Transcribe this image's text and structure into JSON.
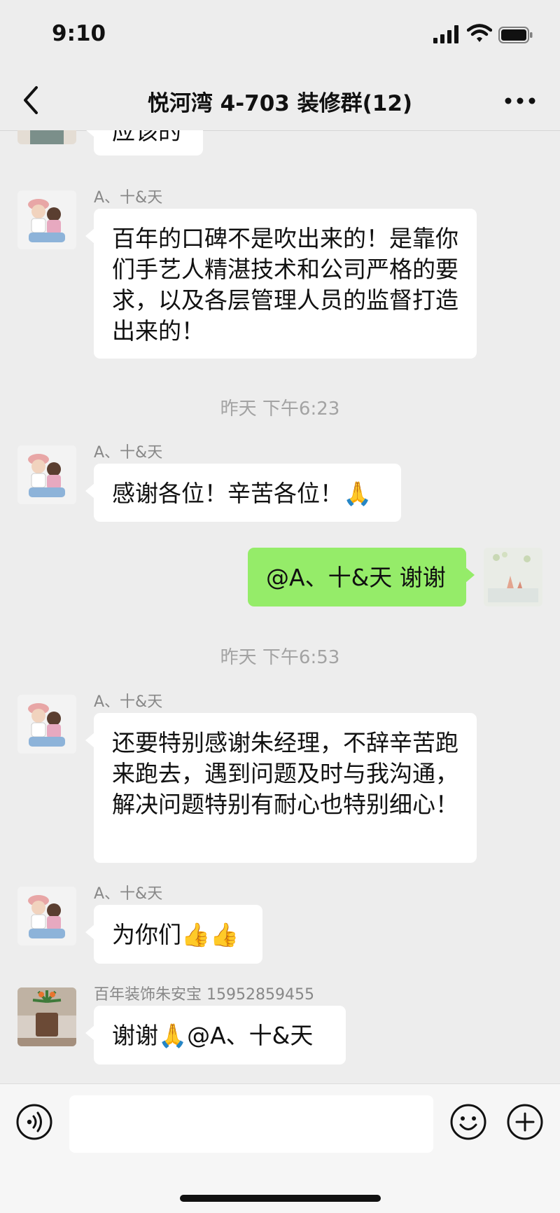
{
  "status_bar": {
    "time": "9:10"
  },
  "nav": {
    "title": "悦河湾 4-703 装修群(12)"
  },
  "messages": [
    {
      "sender": "",
      "text": "应该的"
    },
    {
      "sender": "A、十&天",
      "text": "百年的口碑不是吹出来的！是靠你们手艺人精湛技术和公司严格的要求，以及各层管理人员的监督打造出来的！"
    },
    {
      "timestamp": "昨天 下午6:23"
    },
    {
      "sender": "A、十&天",
      "text": "感谢各位！辛苦各位！🙏"
    },
    {
      "text": "@A、十&天 谢谢"
    },
    {
      "timestamp": "昨天 下午6:53"
    },
    {
      "sender": "A、十&天",
      "text": "还要特别感谢朱经理，不辞辛苦跑来跑去，遇到问题及时与我沟通，解决问题特别有耐心也特别细心！"
    },
    {
      "sender": "A、十&天",
      "text": "为你们👍👍"
    },
    {
      "sender": "百年装饰朱安宝 15952859455",
      "text": "谢谢🙏@A、十&天"
    }
  ],
  "colors": {
    "chat_bg": "#ededed",
    "my_bubble": "#95ec69",
    "other_bubble": "#ffffff",
    "meta_text": "#888888"
  },
  "icons": [
    "back-chevron-icon",
    "more-dots-icon",
    "voice-icon",
    "emoji-face-icon",
    "plus-icon",
    "signal-icon",
    "wifi-icon",
    "battery-icon"
  ]
}
